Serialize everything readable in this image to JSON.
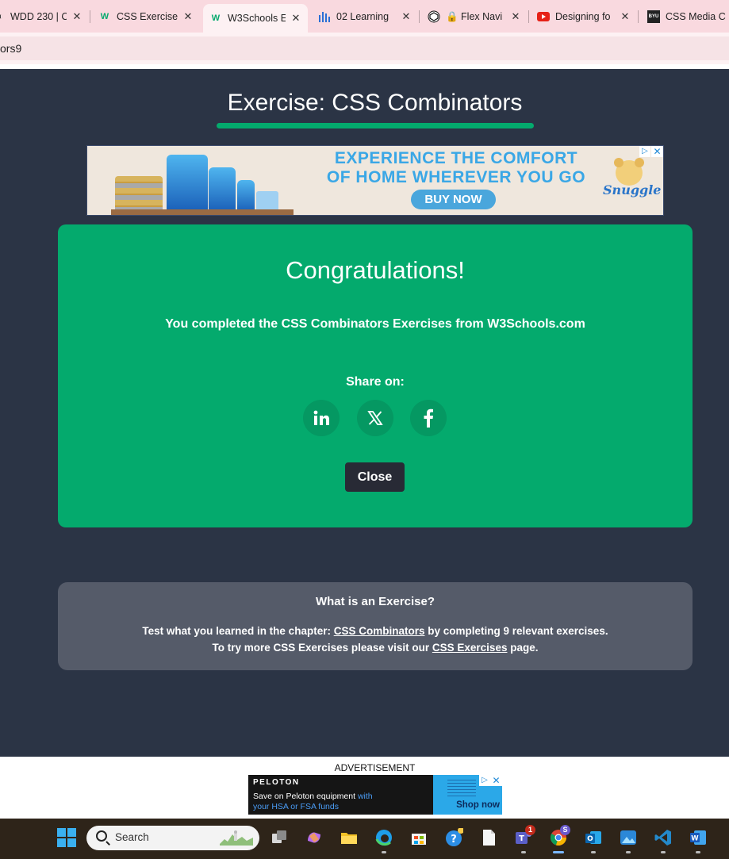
{
  "browser": {
    "tabs": [
      {
        "title": "WDD 230 | C",
        "icon": "chart-icon"
      },
      {
        "title": "CSS Exercise",
        "icon": "w3schools-icon"
      },
      {
        "title": "W3Schools E",
        "icon": "w3schools-icon",
        "active": true
      },
      {
        "title": "02 Learning",
        "icon": "bar-chart-icon"
      },
      {
        "title": "🔒 Flex Navi",
        "icon": "codepen-icon"
      },
      {
        "title": "Designing fo",
        "icon": "youtube-icon"
      },
      {
        "title": "CSS Media C",
        "icon": "byu-icon"
      }
    ],
    "tab_close": "✕",
    "address": "ors9"
  },
  "page": {
    "title": "Exercise: CSS Combinators",
    "ad": {
      "line1": "EXPERIENCE THE COMFORT",
      "line2": "OF HOME WHEREVER YOU GO",
      "button": "BUY NOW",
      "brand": "Snuggle",
      "choices": "▷",
      "close": "✕"
    },
    "congrats": {
      "heading": "Congratulations!",
      "message": "You completed the CSS Combinators Exercises from W3Schools.com",
      "share_label": "Share on:",
      "close_button": "Close"
    },
    "info": {
      "question": "What is an Exercise?",
      "line1_pre": "Test what you learned in the chapter: ",
      "line1_link": "CSS Combinators",
      "line1_post": " by completing 9 relevant exercises.",
      "line2_pre": "To try more CSS Exercises please visit our ",
      "line2_link": "CSS Exercises",
      "line2_post": " page."
    },
    "bottom_ad": {
      "label": "ADVERTISEMENT",
      "brand": "PELOTON",
      "text1_plain": "Save on Peloton equipment ",
      "text1_colored": "with",
      "text2": "your HSA or FSA funds",
      "cta": "Shop now",
      "choices": "▷",
      "close": "✕"
    }
  },
  "taskbar": {
    "search_placeholder": "Search",
    "teams_badge": "1",
    "chrome_badge": "S"
  }
}
